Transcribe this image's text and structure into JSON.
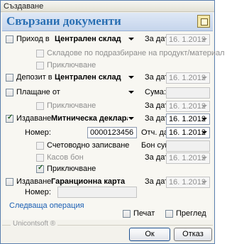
{
  "window": {
    "title": "Създаване"
  },
  "header": {
    "title": "Свързани документи"
  },
  "sections": {
    "receipt": {
      "label": "Приход в",
      "warehouse": "Централен склад",
      "date_label": "За дата:",
      "date": "16. 1.2012",
      "sub1": "Складове по подразбиране на продукт/материал",
      "sub2": "Приключване"
    },
    "deposit": {
      "label": "Депозит в",
      "warehouse": "Централен склад",
      "date_label": "За дата:",
      "date": "16. 1.2012"
    },
    "payment": {
      "label": "Плащане от",
      "amount_label": "Сума:",
      "date_label": "За дата:",
      "date": "16. 1.2012",
      "sub1": "Приключване"
    },
    "issue": {
      "label": "Издаване",
      "document": "Митническа декларация за в",
      "date_label": "За дата:",
      "date": "16. 1.2012",
      "number_label": "Номер:",
      "number": "0000123456",
      "report_date_label": "Отч. дата:",
      "report_date": "16. 1.2012",
      "sub1": "Счетоводно записване",
      "sub2": "Касов бон",
      "sub3": "Приключване",
      "sum_label": "Бон сума:",
      "date2_label": "За дата:",
      "date2": "16. 1.2012"
    },
    "warranty": {
      "label": "Издаване",
      "document": "Гаранционна карта",
      "date_label": "За дата:",
      "date": "16. 1.2012",
      "number_label": "Номер:"
    }
  },
  "next_operation": "Следваща операция",
  "print_label": "Печат",
  "preview_label": "Преглед",
  "brand": "Unicontsoft ®",
  "ok_label": "Ок",
  "cancel_label": "Отказ"
}
